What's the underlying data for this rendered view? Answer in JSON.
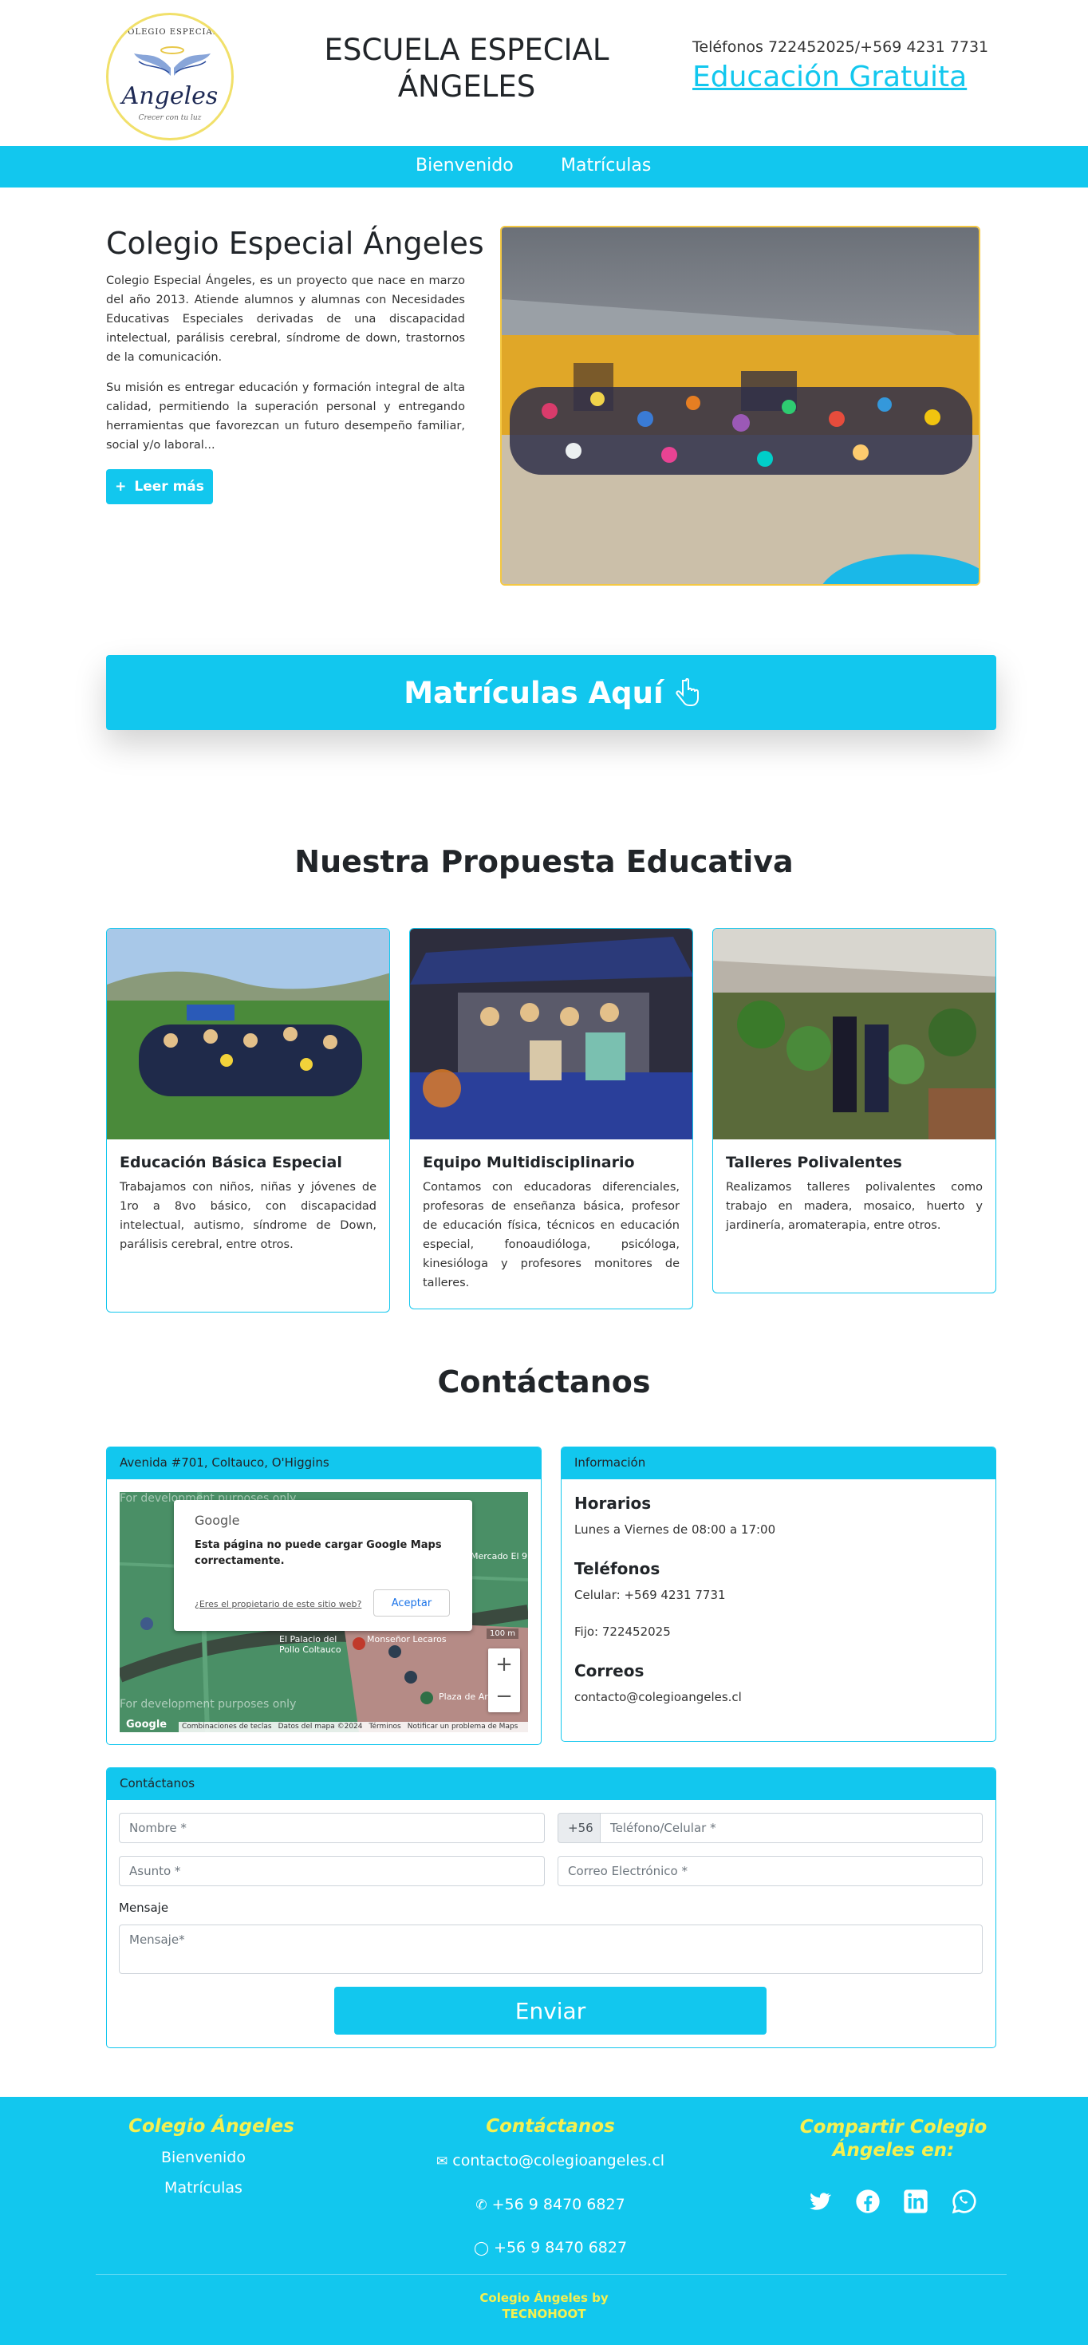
{
  "header": {
    "logo": {
      "top": "COLEGIO    ESPECIAL",
      "name": "Angeles",
      "tagline": "Crecer con tu luz"
    },
    "title_line1": "ESCUELA ESPECIAL",
    "title_line2": "ÁNGELES",
    "phones": "Teléfonos 722452025/+569 4231 7731",
    "edu_link": "Educación Gratuita"
  },
  "nav": {
    "items": [
      "Bienvenido",
      "Matrículas"
    ]
  },
  "intro": {
    "title": "Colegio Especial Ángeles",
    "paragraph1": "Colegio Especial Ángeles, es un proyecto que nace en marzo del año 2013. Atiende alumnos y alumnas con Necesidades Educativas Especiales derivadas de una discapacidad intelectual, parálisis cerebral, síndrome de down, trastornos de la comunicación.",
    "paragraph2": "Su misión es entregar educación y formación integral de alta calidad, permitiendo la superación personal y entregando herramientas que favorezcan un futuro desempeño familiar, social y/o laboral...",
    "more_button": "Leer más"
  },
  "banner": {
    "label": "Matrículas Aquí"
  },
  "proposal": {
    "title": "Nuestra Propuesta Educativa",
    "cards": [
      {
        "title": "Educación Básica Especial",
        "text": "Trabajamos con niños, niñas y jóvenes de 1ro a 8vo básico, con discapacidad intelectual, autismo, síndrome de Down, parálisis cerebral, entre otros."
      },
      {
        "title": "Equipo Multidisciplinario",
        "text": "Contamos con educadoras diferenciales, profesoras de enseñanza básica, profesor de educación física, técnicos en educación especial, fonoaudióloga, psicóloga, kinesióloga y profesores monitores de talleres."
      },
      {
        "title": "Talleres Polivalentes",
        "text": "Realizamos talleres polivalentes como trabajo en madera, mosaico, huerto y jardinería, aromaterapia, entre otros."
      }
    ]
  },
  "contact": {
    "title": "Contáctanos",
    "address": "Avenida #701, Coltauco, O'Higgins",
    "map": {
      "dialog_brand": "Google",
      "dialog_text": "Esta página no puede cargar Google Maps correctamente.",
      "dialog_link": "¿Eres el propietario de este sitio web?",
      "dialog_button": "Aceptar",
      "dev_text": "For development purposes only",
      "place1": "El Palacio del Pollo Coltauco",
      "place2": "Monseñor Lecaros",
      "place3": "Plaza de Armas",
      "place4": "Mercado El 9",
      "footer_links": [
        "Combinaciones de teclas",
        "Datos del mapa ©2024",
        "Términos",
        "Notificar un problema de Maps"
      ],
      "google_logo": "Google",
      "scale": "100 m"
    },
    "info": {
      "head": "Información",
      "hours_title": "Horarios",
      "hours": "Lunes a Viernes de 08:00 a 17:00",
      "phones_title": "Teléfonos",
      "mobile": "Celular: +569 4231 7731",
      "landline": "Fijo: 722452025",
      "mail_title": "Correos",
      "mail": "contacto@colegioangeles.cl"
    },
    "form": {
      "head": "Contáctanos",
      "name": "Nombre *",
      "prefix": "+56",
      "phone": "Teléfono/Celular *",
      "subject": "Asunto *",
      "email": "Correo Electrónico *",
      "message_label": "Mensaje",
      "message": "Mensaje*",
      "send": "Enviar"
    }
  },
  "footer": {
    "col1_title": "Colegio Ángeles",
    "col1_links": [
      "Bienvenido",
      "Matrículas"
    ],
    "col2_title": "Contáctanos",
    "email": "contacto@colegioangeles.cl",
    "phone1": "+56 9 8470 6827",
    "phone2": "+56 9 8470 6827",
    "col3_title_line1": "Compartir Colegio",
    "col3_title_line2": "Ángeles en:",
    "credit_line1": "Colegio Ángeles by",
    "credit_line2": "TECNOHOOT"
  },
  "colors": {
    "accent": "#12c7ee",
    "footer_title": "#f6f04f",
    "photo_border": "#f4c843"
  }
}
